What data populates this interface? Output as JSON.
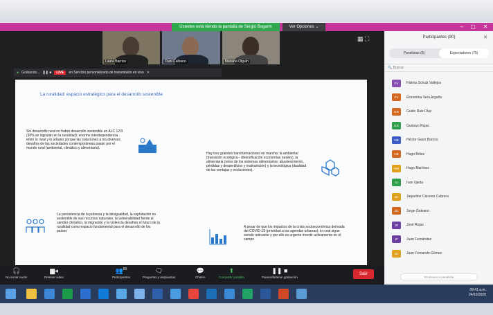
{
  "banner": {
    "sharing_text": "Ustedes está viendo la pantalla de Sergio Bogarín",
    "view_options": "Ver Opciones ⌄"
  },
  "thumbnails": [
    {
      "name": "Laura Barrios",
      "color": "#7d7462"
    },
    {
      "name": "Dani Calbano",
      "color": "#6f7a8c"
    },
    {
      "name": "Mariana Olguín",
      "color": "#8b857b"
    }
  ],
  "share_toolbar": {
    "meeting": "Grabando...",
    "live": "LIVE",
    "stream": "en Servicio personalizado de transmisión en vivo"
  },
  "slide": {
    "title": "La ruralidad: espacio estratégico para el desarrollo sostenible",
    "block1": "Sin desarrollo rural no habrá desarrollo sostenible en ALC 12/3 (30% se lograrán en la ruralidad): enorme interdependencia entre lo rural y lo urbano porque las soluciones a los diversos desafíos de las sociedades contemporáneas pasan por el mundo rural (ambiental, climático y alimentario).",
    "block2": "Hay tres grandes transformaciones en marcha: la ambiental (transición ecológica - diversificación economías rurales), la alimentaria (retos de los sistemas alimentarios: abastecimiento, pérdidas y desperdicios y malnutrición) y la tecnológica (dualidad de las ventajas y exclusiones).",
    "block3": "La persistencia de la pobreza y la desigualdad, la explotación no sostenible de sus recursos naturales, la vulnerabilidad frente al cambio climático, la migración y la violencia desafían el futuro de la ruralidad como espacio fundamental para el desarrollo de los países",
    "block4": "A pesar de que los impactos de la crisis socioeconómica derivada del COVID-19 (prioridad a las agendas urbanas): lo rural sigue siendo relevante y por ello es urgente invertir activamente en el campo"
  },
  "toolbar": {
    "audio": "No iniciar Audio",
    "video": "Detener video",
    "participants": "Participantes",
    "participants_count": "80",
    "qa": "Preguntas y respuestas",
    "chat": "Chateo",
    "share": "Compartir pantalla",
    "record": "Pausar/detener grabación",
    "exit": "Salir"
  },
  "panel": {
    "title": "Participantes (80)",
    "tab_panelists": "Panelistas (8)",
    "tab_attendees": "Espectadores (75)",
    "search_placeholder": "Buscar",
    "participants": [
      {
        "initials": "FV",
        "name": "Fátima Schulz Vallejos",
        "color": "#8a4fb0"
      },
      {
        "initials": "FV",
        "name": "Florentina Vera Argaña",
        "color": "#d2691e"
      },
      {
        "initials": "GR",
        "name": "Guido Ruiz Díaz",
        "color": "#d2691e"
      },
      {
        "initials": "GR",
        "name": "Gustavo Rojas",
        "color": "#2e9e4a"
      },
      {
        "initials": "HB",
        "name": "Héctor Gaon Barrios",
        "color": "#3b5cc4"
      },
      {
        "initials": "HB",
        "name": "Hugo Britez",
        "color": "#d2691e"
      },
      {
        "initials": "HM",
        "name": "Hugo Martínez",
        "color": "#e0a020"
      },
      {
        "initials": "IU",
        "name": "Ivan Ujeda",
        "color": "#2e9e4a"
      },
      {
        "initials": "JC",
        "name": "Jaqueline Cáceres Cabrera",
        "color": "#e0a020"
      },
      {
        "initials": "JG",
        "name": "Jorge Galeano",
        "color": "#d2691e"
      },
      {
        "initials": "JR",
        "name": "José Rojas",
        "color": "#6a3fa0"
      },
      {
        "initials": "JF",
        "name": "Juan Fernández",
        "color": "#6a3fa0"
      },
      {
        "initials": "JG",
        "name": "Juan Fernando Gómez",
        "color": "#e0a020"
      }
    ],
    "admit_button": "Promover a panelista"
  },
  "taskbar": {
    "time": "09:41 a.m.",
    "date": "24/10/2020"
  }
}
